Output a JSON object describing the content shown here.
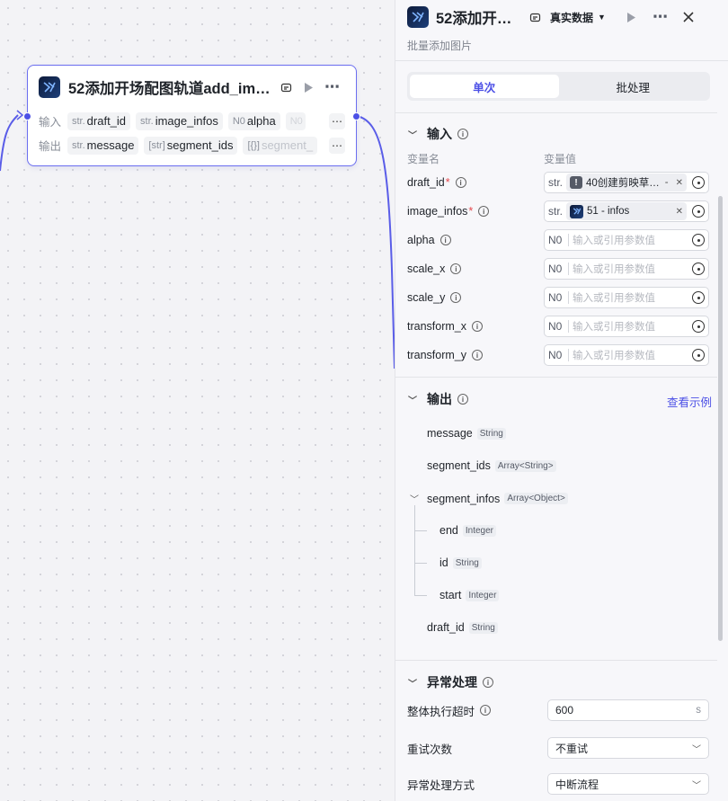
{
  "node": {
    "title": "52添加开场配图轨道add_im…",
    "inputs_label": "输入",
    "outputs_label": "输出",
    "inputs": [
      {
        "type": "str.",
        "name": "draft_id"
      },
      {
        "type": "str.",
        "name": "image_infos"
      },
      {
        "type": "N0",
        "name": "alpha"
      },
      {
        "type": "N0",
        "name": ""
      }
    ],
    "outputs": [
      {
        "type": "str.",
        "name": "message"
      },
      {
        "type": "[str]",
        "name": "segment_ids"
      },
      {
        "type": "[{}]",
        "name": "segment_"
      }
    ],
    "more": "⋯"
  },
  "panel": {
    "title": "52添加开…",
    "data_select": "真实数据",
    "subtitle": "批量添加图片",
    "tabs": [
      "单次",
      "批处理"
    ],
    "input_section": {
      "title": "输入",
      "col_name": "变量名",
      "col_value": "变量值",
      "params": [
        {
          "name": "draft_id",
          "required": true,
          "type": "str.",
          "ref_label": "40创建剪映草…",
          "ref_suffix": "-",
          "ref_kind": "warn"
        },
        {
          "name": "image_infos",
          "required": true,
          "type": "str.",
          "ref_label": "51 - infos",
          "ref_suffix": "",
          "ref_kind": "plugin"
        },
        {
          "name": "alpha",
          "required": false,
          "type": "N0",
          "placeholder": "输入或引用参数值"
        },
        {
          "name": "scale_x",
          "required": false,
          "type": "N0",
          "placeholder": "输入或引用参数值"
        },
        {
          "name": "scale_y",
          "required": false,
          "type": "N0",
          "placeholder": "输入或引用参数值"
        },
        {
          "name": "transform_x",
          "required": false,
          "type": "N0",
          "placeholder": "输入或引用参数值"
        },
        {
          "name": "transform_y",
          "required": false,
          "type": "N0",
          "placeholder": "输入或引用参数值"
        }
      ]
    },
    "output_section": {
      "title": "输出",
      "example_link": "查看示例",
      "fields": [
        {
          "name": "message",
          "type": "String"
        },
        {
          "name": "segment_ids",
          "type": "Array<String>"
        },
        {
          "name": "segment_infos",
          "type": "Array<Object>"
        },
        {
          "name": "end",
          "type": "Integer"
        },
        {
          "name": "id",
          "type": "String"
        },
        {
          "name": "start",
          "type": "Integer"
        },
        {
          "name": "draft_id",
          "type": "String"
        }
      ]
    },
    "exception_section": {
      "title": "异常处理",
      "timeout_label": "整体执行超时",
      "timeout_value": "600",
      "timeout_unit": "s",
      "retry_label": "重试次数",
      "retry_value": "不重试",
      "handling_label": "异常处理方式",
      "handling_value": "中断流程"
    }
  },
  "colors": {
    "accent": "#4c50e6",
    "required": "#e5484d"
  }
}
